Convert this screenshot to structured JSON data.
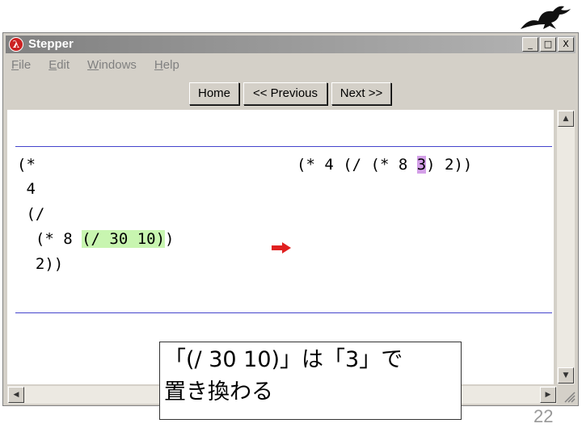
{
  "window": {
    "title": "Stepper",
    "controls": [
      "_",
      "□",
      "X"
    ]
  },
  "menu": [
    "File",
    "Edit",
    "Windows",
    "Help"
  ],
  "toolbar": {
    "home": "Home",
    "previous": "<< Previous",
    "next": "Next >>"
  },
  "stepper": {
    "left_lines": [
      "(*",
      " 4",
      " (/",
      "  (* 8 ",
      "  2))"
    ],
    "left_highlight": "(/ 30 10)",
    "left_after_highlight": ")",
    "right_before": "(* 4 (/ (* 8 ",
    "right_highlight": "3",
    "right_after": ") 2))",
    "arrow": "➡"
  },
  "callout": {
    "line1": "「(/ 30 10)」は「3」で",
    "line2": "置き換わる"
  },
  "page_number": "22",
  "colors": {
    "highlight_green": "#c8f5b0",
    "highlight_purple": "#d4a0e8",
    "arrow": "#e02020",
    "separator": "#4444cc"
  }
}
